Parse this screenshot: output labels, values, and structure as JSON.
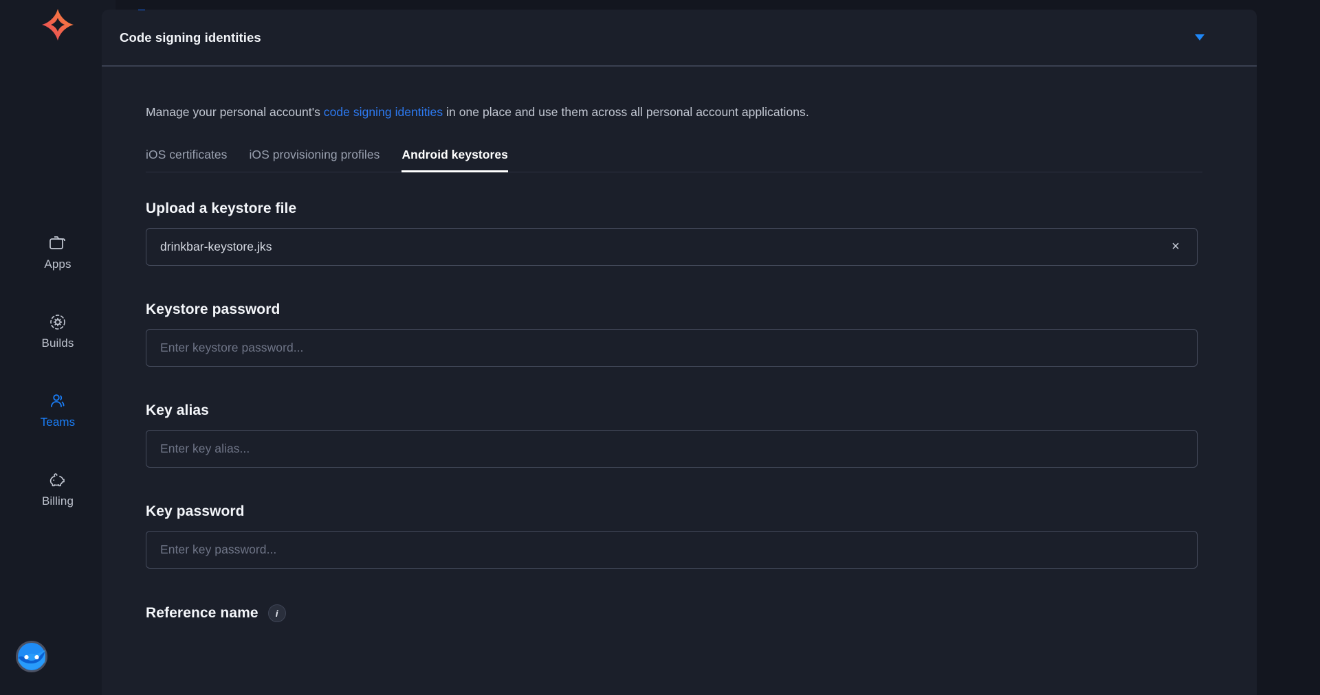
{
  "colors": {
    "page_background": "#13161f",
    "sidebar_background": "#161a24",
    "panel_background": "#1b1f2a",
    "accent_blue": "#1a6dfb",
    "link_blue": "#2d7bf4",
    "active_nav_blue": "#1a7ef8",
    "logo_gradient_start": "#f97a3d",
    "logo_gradient_end": "#e8445a",
    "text_primary": "#f4f6fa",
    "text_secondary": "#c3c8d3",
    "placeholder": "#6e7486",
    "input_border": "#454b5c"
  },
  "sidebar": {
    "logo_name": "bitrise-star-logo",
    "items": [
      {
        "label": "Apps",
        "icon": "folder-icon",
        "active": false
      },
      {
        "label": "Builds",
        "icon": "build-gear-icon",
        "active": false
      },
      {
        "label": "Teams",
        "icon": "people-icon",
        "active": true
      },
      {
        "label": "Billing",
        "icon": "piggy-bank-icon",
        "active": false
      }
    ],
    "avatar_name": "user-avatar"
  },
  "panel": {
    "title": "Code signing identities",
    "collapse_icon": "chevron-down-icon"
  },
  "intro": {
    "before_link": "Manage your personal account's ",
    "link_text": "code signing identities",
    "after_link": " in one place and use them across all personal account applications."
  },
  "tabs": [
    {
      "label": "iOS certificates",
      "active": false
    },
    {
      "label": "iOS provisioning profiles",
      "active": false
    },
    {
      "label": "Android keystores",
      "active": true
    }
  ],
  "form": {
    "upload": {
      "label": "Upload a keystore file",
      "value": "drinkbar-keystore.jks",
      "clear_icon": "close-icon",
      "clear_label": "×"
    },
    "keystore_password": {
      "label": "Keystore password",
      "value": "",
      "placeholder": "Enter keystore password..."
    },
    "key_alias": {
      "label": "Key alias",
      "value": "",
      "placeholder": "Enter key alias..."
    },
    "key_password": {
      "label": "Key password",
      "value": "",
      "placeholder": "Enter key password..."
    },
    "reference_name": {
      "label": "Reference name",
      "info_icon": "info-icon",
      "info_glyph": "i"
    }
  }
}
